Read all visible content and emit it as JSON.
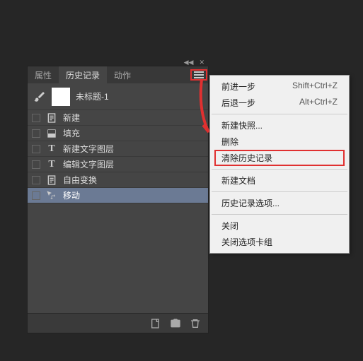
{
  "tabs": {
    "properties": "属性",
    "history": "历史记录",
    "actions": "动作"
  },
  "document": {
    "title": "未标题-1"
  },
  "history": [
    {
      "icon": "doc",
      "label": "新建"
    },
    {
      "icon": "fill",
      "label": "填充"
    },
    {
      "icon": "text",
      "label": "新建文字图层"
    },
    {
      "icon": "text",
      "label": "编辑文字图层"
    },
    {
      "icon": "doc",
      "label": "自由变换"
    },
    {
      "icon": "move",
      "label": "移动",
      "selected": true
    }
  ],
  "menu": {
    "forward": {
      "label": "前进一步",
      "shortcut": "Shift+Ctrl+Z"
    },
    "back": {
      "label": "后退一步",
      "shortcut": "Alt+Ctrl+Z"
    },
    "snapshot": "新建快照...",
    "delete": "删除",
    "clear": "清除历史记录",
    "newdoc": "新建文档",
    "options": "历史记录选项...",
    "close": "关闭",
    "closegroup": "关闭选项卡组"
  }
}
